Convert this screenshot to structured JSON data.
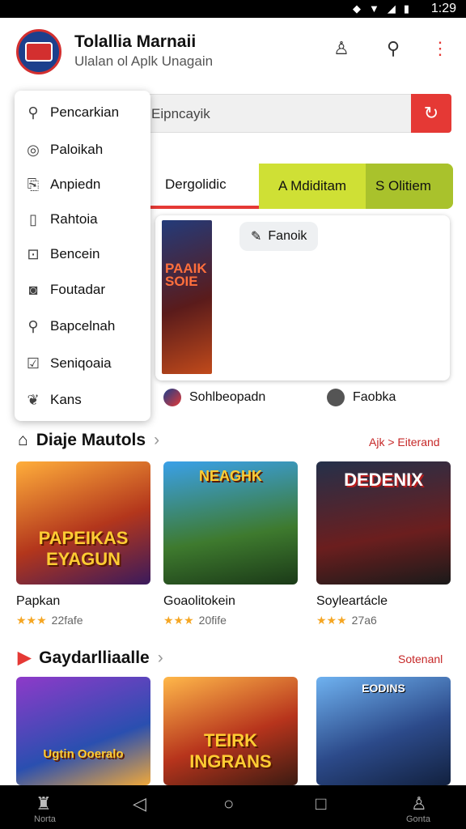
{
  "status": {
    "time": "1:29"
  },
  "header": {
    "title": "Tolallia Marnaii",
    "subtitle": "Ulalan ol Aplk Unagain"
  },
  "search": {
    "placeholder": "Eipncayik"
  },
  "dropdown": {
    "items": [
      {
        "label": "Pencarkian",
        "icon": "search-icon"
      },
      {
        "label": "Paloikah",
        "icon": "circle-icon"
      },
      {
        "label": "Anpiedn",
        "icon": "doc-icon"
      },
      {
        "label": "Rahtoia",
        "icon": "page-icon"
      },
      {
        "label": "Bencein",
        "icon": "file-icon"
      },
      {
        "label": "Foutadar",
        "icon": "disc-icon"
      },
      {
        "label": "Bapcelnah",
        "icon": "magnifier-icon"
      },
      {
        "label": "Seniqoaia",
        "icon": "check-icon"
      },
      {
        "label": "Kans",
        "icon": "leaf-icon"
      }
    ]
  },
  "tabs": [
    {
      "label": "Dergolidic"
    },
    {
      "label": "A Mdiditam"
    },
    {
      "label": "S Olitiem"
    }
  ],
  "featured": {
    "cover_title": "PAAIK SOIE",
    "badge": "Fanoik",
    "links": [
      {
        "label": "Sohlbeopadn"
      },
      {
        "label": "Faobka"
      }
    ]
  },
  "section1": {
    "title": "Diaje Mautols",
    "link": "Ajk > Eiterand",
    "cards": [
      {
        "title": "Papkan",
        "rating": "22fafe",
        "cover": "PAPEIKAS EYAGUN"
      },
      {
        "title": "Goaolitokein",
        "rating": "20fife",
        "cover": "NEAGHK"
      },
      {
        "title": "Soyleartácle",
        "rating": "27a6",
        "cover": "DEDENIX"
      }
    ]
  },
  "section2": {
    "title": "Gaydarlliaalle",
    "link": "Sotenanl",
    "cards": [
      {
        "cover": "Ugtin Ooeralo"
      },
      {
        "cover": "TEIRK INGRANS"
      },
      {
        "cover": "EODINS"
      }
    ]
  },
  "bottom_nav": {
    "left_label": "Norta",
    "right_label": "Gonta"
  },
  "colors": {
    "accent": "#e53935",
    "tab_bar": "#cfe035"
  }
}
